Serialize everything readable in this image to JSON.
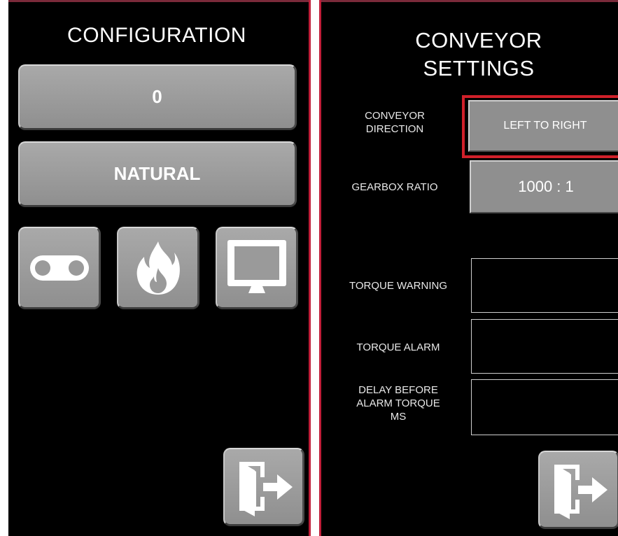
{
  "left": {
    "title": "CONFIGURATION",
    "value_button": "0",
    "mode_button": "NATURAL",
    "icons": [
      "conveyor-icon",
      "fire-icon",
      "monitor-icon"
    ],
    "exit_icon": "exit-door-icon"
  },
  "right": {
    "title_line1": "CONVEYOR",
    "title_line2": "SETTINGS",
    "direction_label_l1": "CONVEYOR",
    "direction_label_l2": "DIRECTION",
    "direction_value": "LEFT TO RIGHT",
    "gearbox_label": "GEARBOX RATIO",
    "gearbox_value": "1000 : 1",
    "torque_warning_label": "TORQUE WARNING",
    "torque_warning_value": "",
    "torque_alarm_label": "TORQUE ALARM",
    "torque_alarm_value": "",
    "delay_label_l1": "DELAY BEFORE",
    "delay_label_l2": "ALARM TORQUE",
    "delay_label_l3": "MS",
    "delay_value": "",
    "exit_icon": "exit-door-icon"
  },
  "colors": {
    "background": "#000000",
    "panel_border": "#c01f3a",
    "button_gray": "#9a9a9a",
    "selected_highlight": "#d0202a",
    "text": "#ffffff"
  }
}
